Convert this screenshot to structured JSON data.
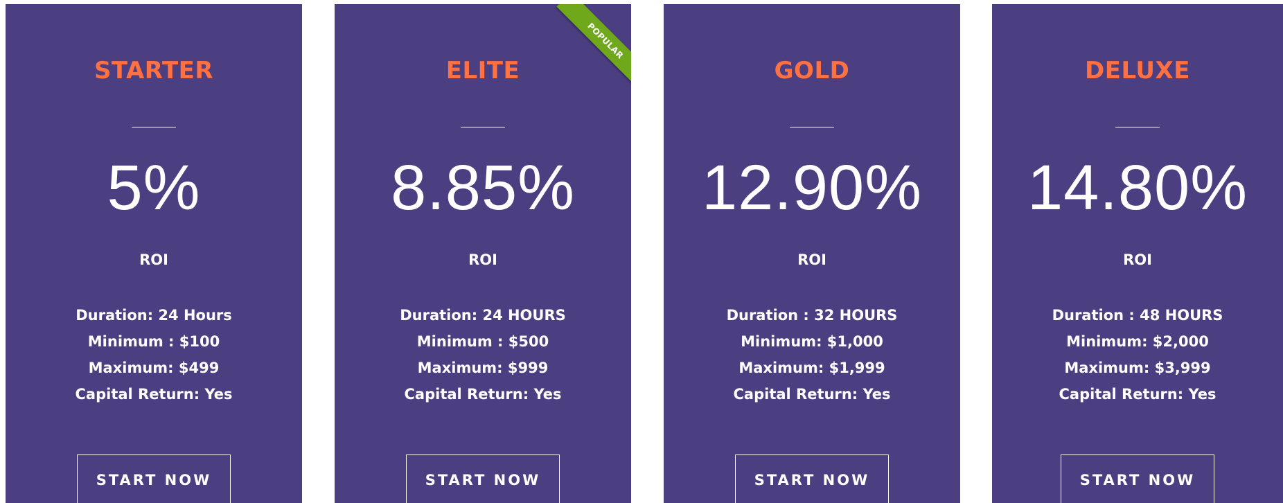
{
  "colors": {
    "card_background": "#4b3f81",
    "plan_title": "#ff7043",
    "text": "#ffffff",
    "ribbon": "#6fa81a"
  },
  "ribbon": {
    "label": "POPULAR"
  },
  "plans": [
    {
      "name": "STARTER",
      "roi": "5%",
      "roi_label": "ROI",
      "duration": "Duration: 24 Hours",
      "minimum": "Minimum : $100",
      "maximum": "Maximum: $499",
      "capital_return": "Capital Return: Yes",
      "button_label": "START NOW"
    },
    {
      "name": "ELITE",
      "roi": "8.85%",
      "roi_label": "ROI",
      "duration": "Duration: 24 HOURS",
      "minimum": "Minimum : $500",
      "maximum": "Maximum: $999",
      "capital_return": "Capital Return: Yes",
      "button_label": "START NOW"
    },
    {
      "name": "GOLD",
      "roi": "12.90%",
      "roi_label": "ROI",
      "duration": "Duration : 32 HOURS",
      "minimum": "Minimum: $1,000",
      "maximum": "Maximum: $1,999",
      "capital_return": "Capital Return: Yes",
      "button_label": "START NOW"
    },
    {
      "name": "DELUXE",
      "roi": "14.80%",
      "roi_label": "ROI",
      "duration": "Duration : 48 HOURS",
      "minimum": "Minimum: $2,000",
      "maximum": "Maximum: $3,999",
      "capital_return": "Capital Return: Yes",
      "button_label": "START NOW"
    }
  ]
}
